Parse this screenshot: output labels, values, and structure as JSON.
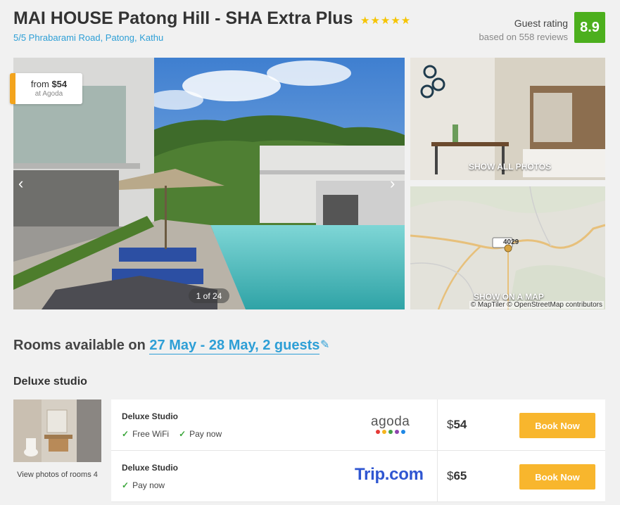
{
  "hotel": {
    "name": "MAI HOUSE Patong Hill - SHA Extra Plus",
    "stars": "★★★★★",
    "address": "5/5 Phrabarami Road, Patong, Kathu"
  },
  "rating": {
    "label": "Guest rating",
    "reviews": "based on 558 reviews",
    "score": "8.9",
    "color": "#4caf1d"
  },
  "gallery": {
    "price_from_prefix": "from",
    "price_from_value": "$54",
    "price_source": "at Agoda",
    "counter": "1 of 24",
    "prev_icon": "chevron-left-icon",
    "next_icon": "chevron-right-icon",
    "show_all_photos": "SHOW ALL PHOTOS",
    "show_on_map": "SHOW ON A MAP",
    "map_road_label": "4029",
    "map_credit": "© MapTiler © OpenStreetMap contributors"
  },
  "rooms": {
    "heading_prefix": "Rooms available on",
    "heading_dates": "27 May - 28 May, 2 guests",
    "edit_icon": "pencil-icon",
    "room_type": "Deluxe studio",
    "view_photos": "View photos of rooms 4",
    "offers": [
      {
        "name": "Deluxe Studio",
        "features": [
          "Free WiFi",
          "Pay now"
        ],
        "provider": "agoda",
        "currency": "$",
        "price": "54",
        "button": "Book Now"
      },
      {
        "name": "Deluxe Studio",
        "features": [
          "Pay now"
        ],
        "provider": "Trip.com",
        "currency": "$",
        "price": "65",
        "button": "Book Now"
      }
    ]
  },
  "colors": {
    "accent": "#2e9fd6",
    "book_button": "#f8b62d",
    "price_tag_border": "#f3a41d"
  }
}
